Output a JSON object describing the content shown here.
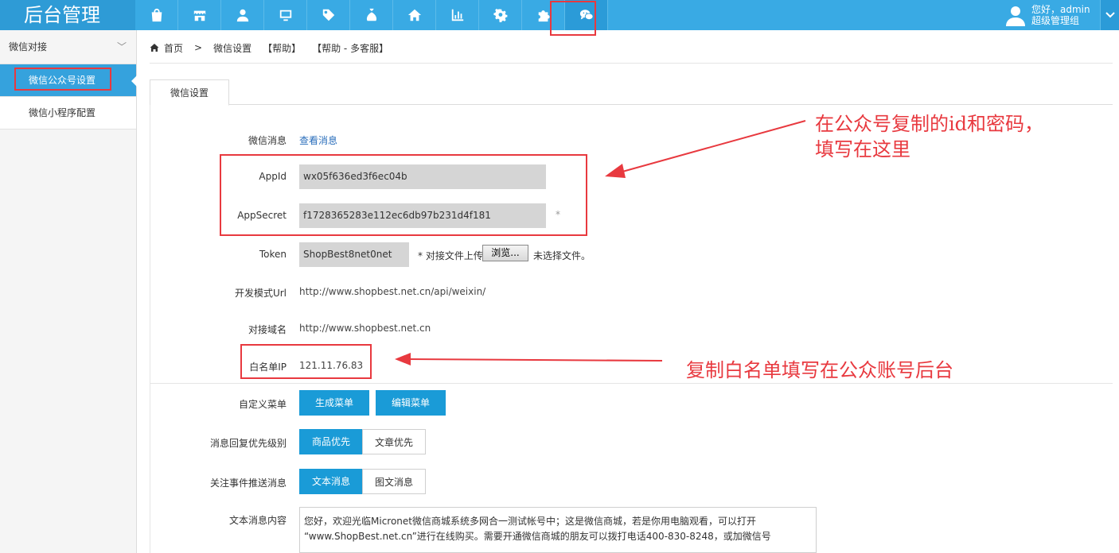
{
  "header": {
    "brand": "后台管理",
    "nav_icons": [
      "bag-icon",
      "store-icon",
      "user-icon",
      "monitor-icon",
      "tag-icon",
      "money-bag-icon",
      "home-icon",
      "bar-chart-icon",
      "gear-icon",
      "puzzle-icon",
      "wechat-icon"
    ],
    "active_index": 10,
    "user": {
      "greeting": "您好，admin",
      "role": "超级管理组"
    }
  },
  "sidebar": {
    "group_label": "微信对接",
    "items": [
      {
        "label": "微信公众号设置",
        "active": true
      },
      {
        "label": "微信小程序配置",
        "active": false
      }
    ]
  },
  "breadcrumb": {
    "home": "首页",
    "items": [
      "微信设置",
      "【帮助】",
      "【帮助 - 多客服】"
    ]
  },
  "tab": {
    "label": "微信设置"
  },
  "form": {
    "message": {
      "label": "微信消息",
      "link": "查看消息"
    },
    "appid": {
      "label": "AppId",
      "value": "wx05f636ed3f6ec04b"
    },
    "appsecret": {
      "label": "AppSecret",
      "value": "f1728365283e112ec6db97b231d4f181",
      "required": "*"
    },
    "token": {
      "label": "Token",
      "value": "ShopBest8net0net",
      "upload_hint": "* 对接文件上传",
      "browse": "浏览...",
      "no_file": "未选择文件。"
    },
    "dev_url": {
      "label": "开发模式Url",
      "value": "http://www.shopbest.net.cn/api/weixin/"
    },
    "domain": {
      "label": "对接域名",
      "value": "http://www.shopbest.net.cn"
    },
    "whitelist": {
      "label": "白名单IP",
      "value": "121.11.76.83"
    },
    "custom_menu": {
      "label": "自定义菜单",
      "btn_generate": "生成菜单",
      "btn_edit": "编辑菜单"
    },
    "reply_priority": {
      "label": "消息回复优先级别",
      "options": [
        "商品优先",
        "文章优先"
      ],
      "selected": 0
    },
    "follow_push": {
      "label": "关注事件推送消息",
      "options": [
        "文本消息",
        "图文消息"
      ],
      "selected": 0
    },
    "text_content": {
      "label": "文本消息内容",
      "line1": "您好，欢迎光临Micronet微信商城系统多网合一测试帐号中；这是微信商城，若是你用电脑观看，可以打开",
      "line2": "“www.ShopBest.net.cn”进行在线购买。需要开通微信商城的朋友可以拨打电话400-830-8248，或加微信号"
    }
  },
  "annotations": {
    "note1_line1": "在公众号复制的id和密码，",
    "note1_line2": "填写在这里",
    "note2": "复制白名单填写在公众账号后台",
    "color": "#e8393f"
  }
}
